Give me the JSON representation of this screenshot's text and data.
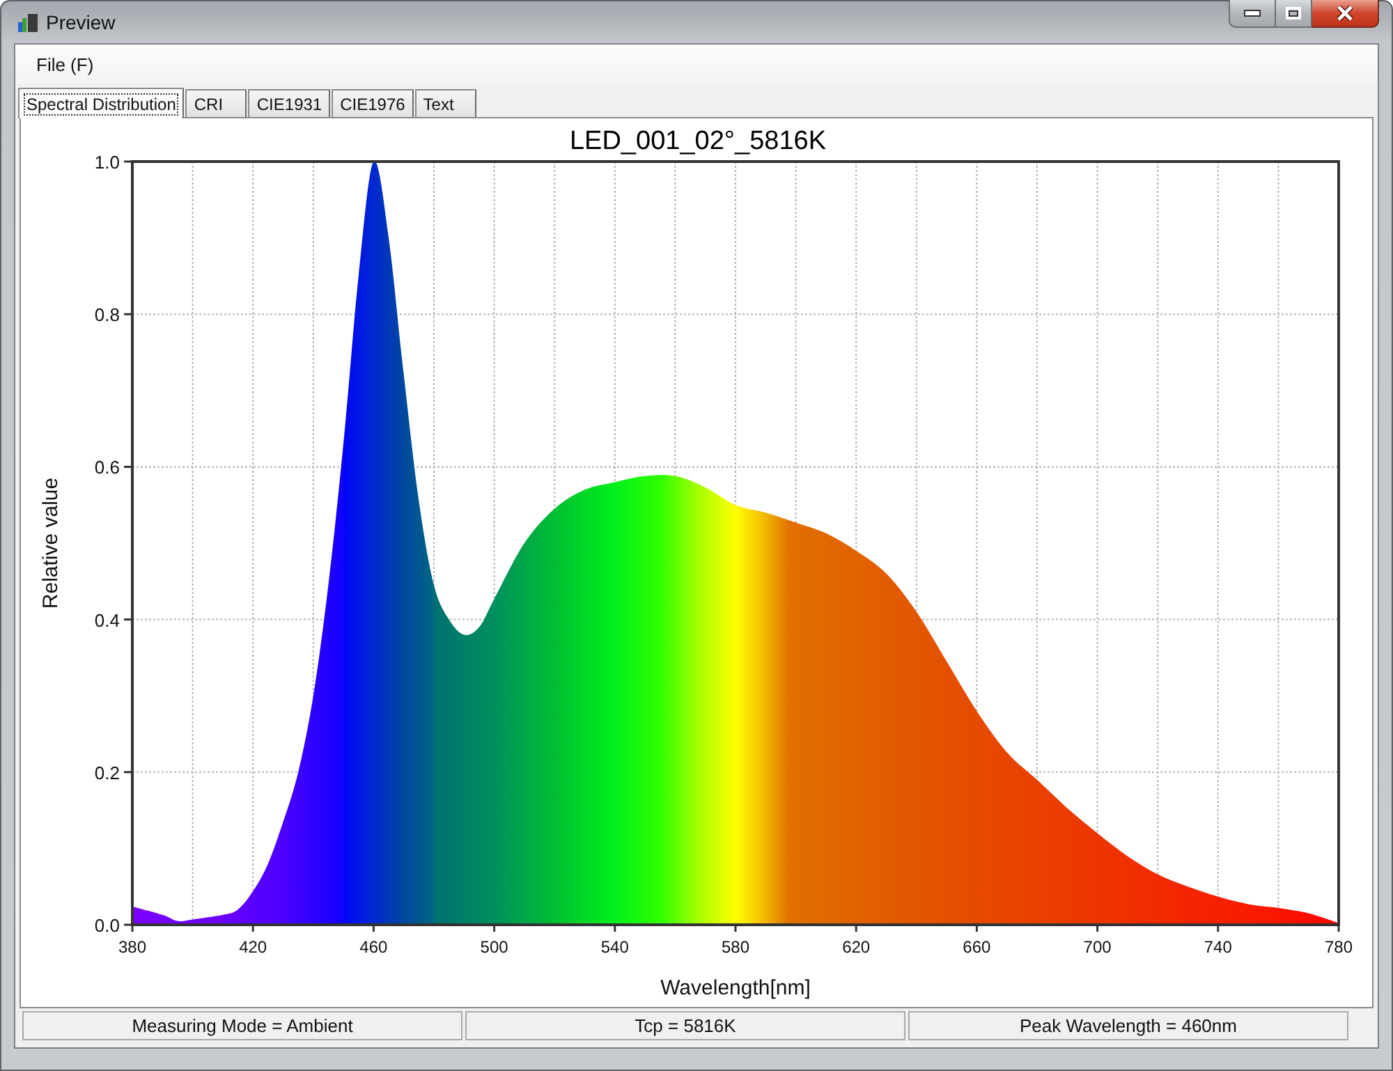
{
  "window": {
    "title": "Preview"
  },
  "menu_bar": [
    {
      "label": "File (F)"
    }
  ],
  "tabs": [
    {
      "label": "Spectral Distribution",
      "selected": true
    },
    {
      "label": "CRI",
      "selected": false
    },
    {
      "label": "CIE1931",
      "selected": false
    },
    {
      "label": "CIE1976",
      "selected": false
    },
    {
      "label": "Text",
      "selected": false
    }
  ],
  "spectrum_panel": {
    "chart_data": {
      "type": "area",
      "title": "LED_001_02°_5816K",
      "xlabel": "Wavelength[nm]",
      "ylabel": "Relative value",
      "x": [
        380,
        390,
        395,
        400,
        410,
        415,
        420,
        425,
        430,
        435,
        440,
        445,
        450,
        455,
        460,
        465,
        470,
        475,
        480,
        485,
        490,
        495,
        500,
        510,
        520,
        530,
        540,
        550,
        560,
        570,
        580,
        590,
        600,
        610,
        620,
        630,
        640,
        650,
        660,
        670,
        680,
        690,
        700,
        710,
        720,
        730,
        740,
        750,
        760,
        770,
        780
      ],
      "series": [
        {
          "values": [
            0.024,
            0.013,
            0.005,
            0.007,
            0.013,
            0.02,
            0.044,
            0.08,
            0.135,
            0.2,
            0.3,
            0.445,
            0.63,
            0.85,
            1.0,
            0.9,
            0.72,
            0.555,
            0.445,
            0.4,
            0.38,
            0.39,
            0.427,
            0.5,
            0.545,
            0.57,
            0.58,
            0.588,
            0.588,
            0.573,
            0.55,
            0.54,
            0.527,
            0.513,
            0.49,
            0.46,
            0.41,
            0.345,
            0.28,
            0.226,
            0.19,
            0.153,
            0.12,
            0.09,
            0.066,
            0.05,
            0.037,
            0.027,
            0.022,
            0.015,
            0.002
          ]
        }
      ],
      "xlim": [
        380,
        780
      ],
      "ylim": [
        0,
        1
      ],
      "xticks": [
        380,
        420,
        460,
        500,
        540,
        580,
        620,
        660,
        700,
        740,
        780
      ],
      "yticks": [
        {
          "value": 0,
          "label": "0.0"
        },
        {
          "value": 0.2,
          "label": "0.2"
        },
        {
          "value": 0.4,
          "label": "0.4"
        },
        {
          "value": 0.6,
          "label": "0.6"
        },
        {
          "value": 0.8,
          "label": "0.8"
        },
        {
          "value": 1.0,
          "label": "1.0"
        }
      ],
      "grid": true
    }
  },
  "status_bar": [
    {
      "text": "Measuring Mode = Ambient"
    },
    {
      "text": "Tcp = 5816K"
    },
    {
      "text": "Peak Wavelength = 460nm"
    }
  ]
}
